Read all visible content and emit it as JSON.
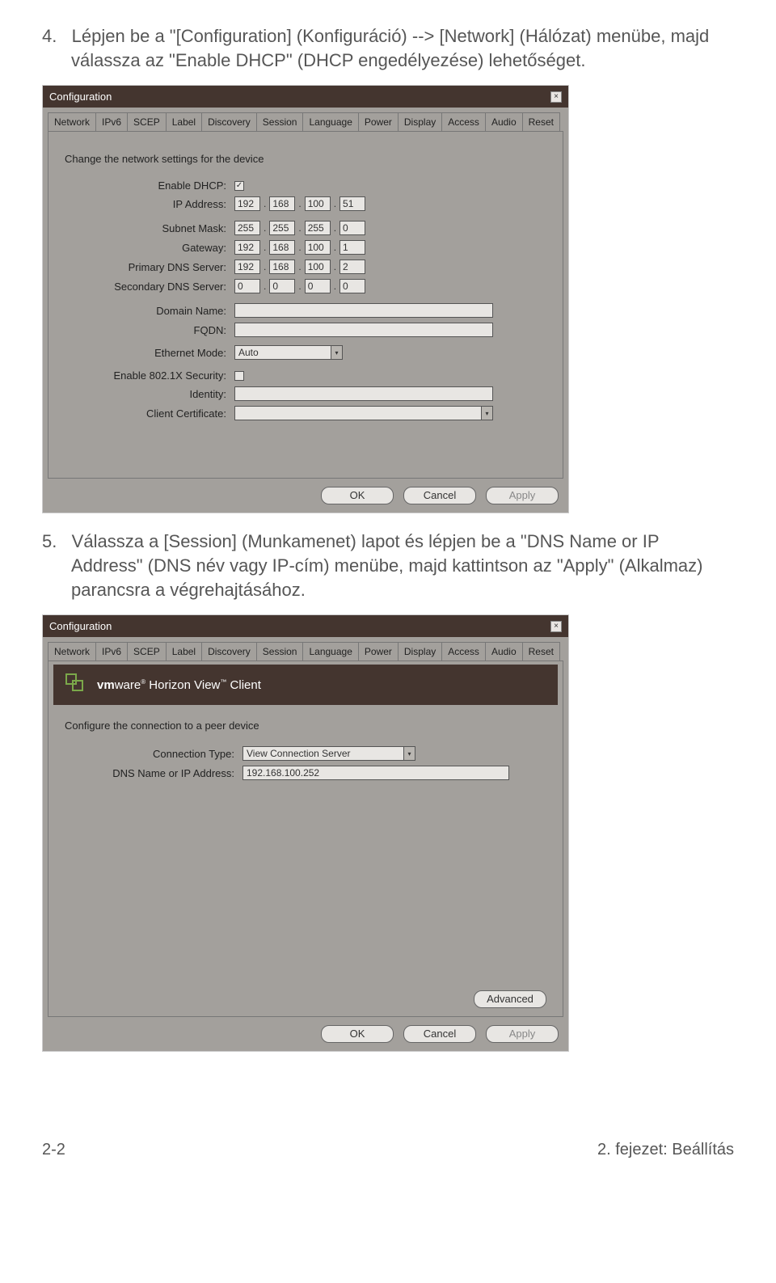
{
  "instructions": {
    "step4": "4.   Lépjen be a \"[Configuration] (Konfiguráció) --> [Network] (Hálózat) menübe, majd válassza az \"Enable DHCP\" (DHCP engedélyezése) lehetőséget.",
    "step5": "5.   Válassza a [Session] (Munkamenet) lapot és lépjen be a \"DNS Name or IP Address\" (DNS név vagy IP-cím) menübe, majd kattintson az \"Apply\" (Alkalmaz) parancsra a végrehajtásához."
  },
  "dialog1": {
    "title": "Configuration",
    "tabs": [
      "Network",
      "IPv6",
      "SCEP",
      "Label",
      "Discovery",
      "Session",
      "Language",
      "Power",
      "Display",
      "Access",
      "Audio",
      "Reset"
    ],
    "desc": "Change the network settings for the device",
    "labels": {
      "enable_dhcp": "Enable DHCP:",
      "ip_address": "IP Address:",
      "subnet_mask": "Subnet Mask:",
      "gateway": "Gateway:",
      "primary_dns": "Primary DNS Server:",
      "secondary_dns": "Secondary DNS Server:",
      "domain_name": "Domain Name:",
      "fqdn": "FQDN:",
      "ethernet_mode": "Ethernet Mode:",
      "enable_8021x": "Enable 802.1X Security:",
      "identity": "Identity:",
      "client_cert": "Client Certificate:"
    },
    "values": {
      "dhcp_checked": "✓",
      "ip": [
        "192",
        "168",
        "100",
        "51"
      ],
      "subnet": [
        "255",
        "255",
        "255",
        "0"
      ],
      "gateway": [
        "192",
        "168",
        "100",
        "1"
      ],
      "primary_dns": [
        "192",
        "168",
        "100",
        "2"
      ],
      "secondary_dns": [
        "0",
        "0",
        "0",
        "0"
      ],
      "ethernet_mode": "Auto"
    },
    "buttons": {
      "ok": "OK",
      "cancel": "Cancel",
      "apply": "Apply"
    }
  },
  "dialog2": {
    "title": "Configuration",
    "tabs": [
      "Network",
      "IPv6",
      "SCEP",
      "Label",
      "Discovery",
      "Session",
      "Language",
      "Power",
      "Display",
      "Access",
      "Audio",
      "Reset"
    ],
    "brand_prefix": "vm",
    "brand_suffix": "ware",
    "brand_rest": " Horizon View",
    "brand_client": " Client",
    "desc": "Configure the connection to a peer device",
    "labels": {
      "connection_type": "Connection Type:",
      "dns_or_ip": "DNS Name or IP Address:"
    },
    "values": {
      "connection_type": "View Connection Server",
      "dns_or_ip": "192.168.100.252"
    },
    "buttons": {
      "advanced": "Advanced",
      "ok": "OK",
      "cancel": "Cancel",
      "apply": "Apply"
    }
  },
  "footer": {
    "left": "2-2",
    "right": "2. fejezet: Beállítás"
  }
}
